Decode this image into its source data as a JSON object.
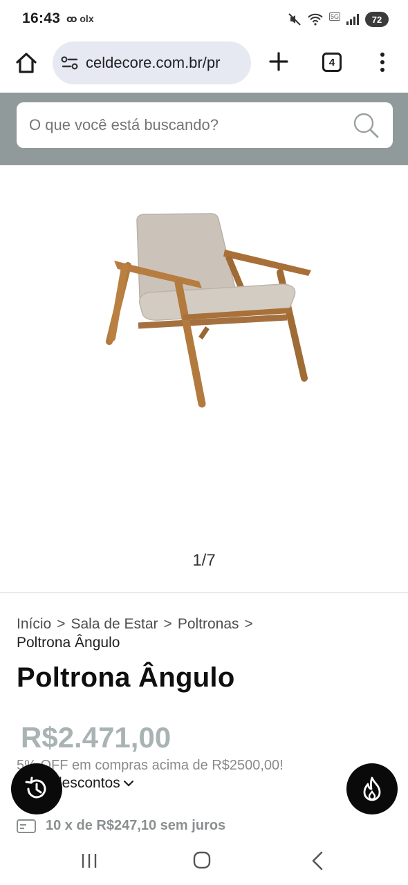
{
  "status_bar": {
    "time": "16:43",
    "notification_icons": "ꝏ olx",
    "network_tag": "5G",
    "battery": "72"
  },
  "browser": {
    "url": "celdecore.com.br/pr",
    "tab_count": "4"
  },
  "search": {
    "placeholder": "O que você está buscando?"
  },
  "gallery": {
    "counter": "1/7"
  },
  "breadcrumb": {
    "items": [
      "Início",
      "Sala de Estar",
      "Poltronas"
    ],
    "current": "Poltrona Ângulo"
  },
  "product": {
    "title": "Poltrona Ângulo",
    "price": "R$2.471,00",
    "promo": "5% OFF em compras acima de R$2500,00!",
    "discounts_label": "descontos",
    "installments": "10 x de R$247,10 sem juros"
  },
  "colors": {
    "search_band": "#909a9b",
    "price": "#aab3b4"
  }
}
